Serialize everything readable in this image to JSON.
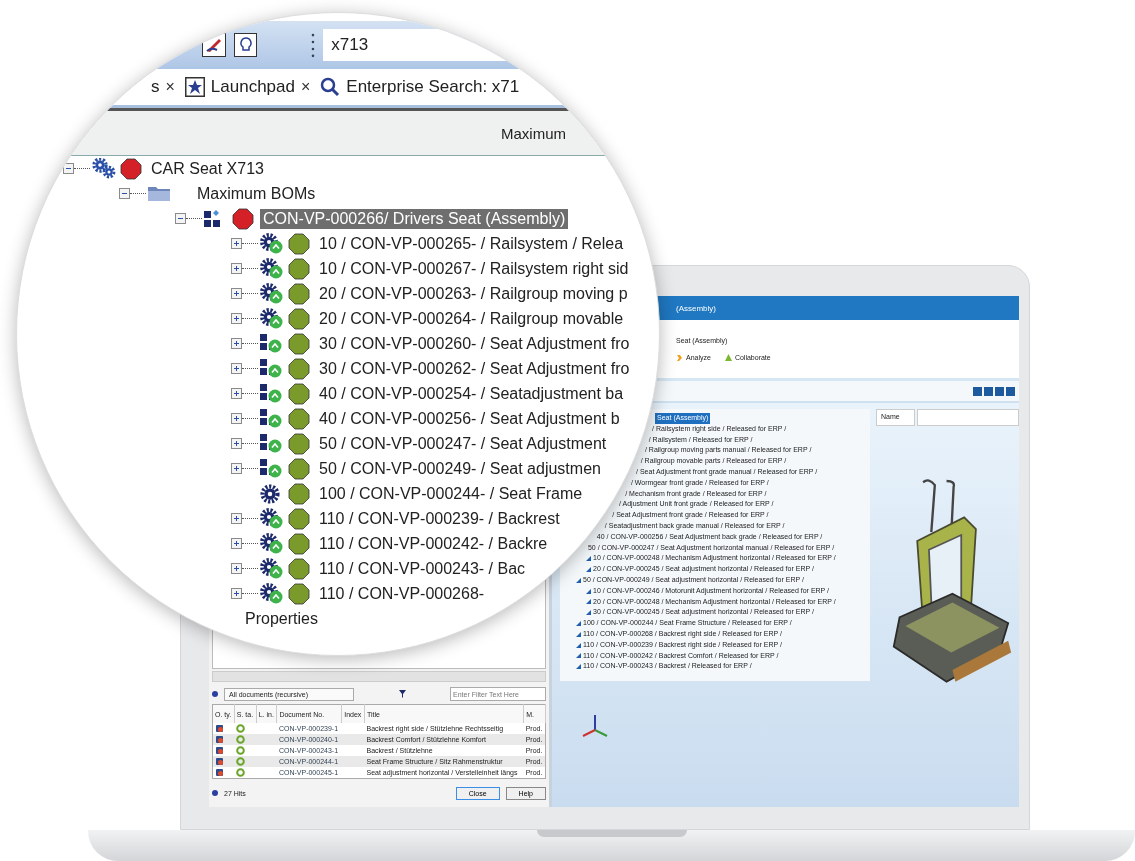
{
  "magnifier": {
    "toolbar": {
      "search": {
        "value": "x713"
      }
    },
    "tabs": [
      {
        "label": "s",
        "close": "×"
      },
      {
        "label": "Launchpad",
        "kind": "star",
        "close": "×"
      },
      {
        "label": "Enterprise Search: x71",
        "kind": "search"
      }
    ],
    "header": "Maximum",
    "tree": [
      {
        "label": "CAR Seat X713",
        "kind": "gears",
        "color": "#d42027",
        "expanded": true,
        "selected": false,
        "children": [
          {
            "label": "Maximum BOMs",
            "kind": "folder",
            "expanded": true,
            "selected": false,
            "children": [
              {
                "label": "CON-VP-000266/ Drivers Seat (Assembly)",
                "kind": "blocks",
                "color": "#d42027",
                "expanded": true,
                "selected": true,
                "children": [
                  {
                    "label": "10 / CON-VP-000265- / Railsystem / Relea",
                    "kind": "gear-badge",
                    "color": "#7a9a2c",
                    "expanded": false,
                    "selected": false
                  },
                  {
                    "label": "10 / CON-VP-000267- / Railsystem right sid",
                    "kind": "gear-badge",
                    "color": "#7a9a2c",
                    "expanded": false,
                    "selected": false
                  },
                  {
                    "label": "20 / CON-VP-000263- / Railgroup moving p",
                    "kind": "gear-badge",
                    "color": "#7a9a2c",
                    "expanded": false,
                    "selected": false
                  },
                  {
                    "label": "20 / CON-VP-000264- / Railgroup movable",
                    "kind": "gear-badge",
                    "color": "#7a9a2c",
                    "expanded": false,
                    "selected": false
                  },
                  {
                    "label": "30 / CON-VP-000260- / Seat Adjustment fro",
                    "kind": "blocks-badge",
                    "color": "#7a9a2c",
                    "expanded": false,
                    "selected": false
                  },
                  {
                    "label": "30 / CON-VP-000262- / Seat Adjustment fro",
                    "kind": "blocks-badge",
                    "color": "#7a9a2c",
                    "expanded": false,
                    "selected": false
                  },
                  {
                    "label": "40 / CON-VP-000254- / Seatadjustment ba",
                    "kind": "blocks-badge",
                    "color": "#7a9a2c",
                    "expanded": false,
                    "selected": false
                  },
                  {
                    "label": "40 / CON-VP-000256- / Seat Adjustment b",
                    "kind": "blocks-badge",
                    "color": "#7a9a2c",
                    "expanded": false,
                    "selected": false
                  },
                  {
                    "label": "50 / CON-VP-000247- / Seat Adjustment",
                    "kind": "blocks-badge",
                    "color": "#7a9a2c",
                    "expanded": false,
                    "selected": false
                  },
                  {
                    "label": "50 / CON-VP-000249- / Seat adjustmen",
                    "kind": "blocks-badge",
                    "color": "#7a9a2c",
                    "expanded": false,
                    "selected": false
                  },
                  {
                    "label": "100 / CON-VP-000244- / Seat Frame",
                    "kind": "gear",
                    "color": "#7a9a2c",
                    "selected": false
                  },
                  {
                    "label": "110 / CON-VP-000239- / Backrest",
                    "kind": "gear-badge",
                    "color": "#7a9a2c",
                    "expanded": false,
                    "selected": false
                  },
                  {
                    "label": "110 / CON-VP-000242- / Backre",
                    "kind": "gear-badge",
                    "color": "#7a9a2c",
                    "expanded": false,
                    "selected": false
                  },
                  {
                    "label": "110 / CON-VP-000243- / Bac",
                    "kind": "gear-badge",
                    "color": "#7a9a2c",
                    "expanded": false,
                    "selected": false
                  },
                  {
                    "label": "110 / CON-VP-000268-",
                    "kind": "gear-badge",
                    "color": "#7a9a2c",
                    "expanded": false,
                    "selected": false
                  }
                ]
              }
            ]
          }
        ]
      }
    ],
    "properties_label": "Properties"
  },
  "left_pane": {
    "filter": {
      "dropdown": "All documents (recursive)",
      "placeholder": "Enter Filter Text Here"
    },
    "table": {
      "columns": [
        "O. ty.",
        "S. ta.",
        "L. in.",
        "Document No.",
        "Index",
        "Title",
        "M."
      ],
      "rows": [
        {
          "document_no": "CON-VP-000239-1",
          "title": "Backrest right side / Stützlehne Rechtsseitig",
          "column_7": "Prod."
        },
        {
          "document_no": "CON-VP-000240-1",
          "title": "Backrest Comfort / Stützlehne Komfort",
          "column_7": "Prod."
        },
        {
          "document_no": "CON-VP-000243-1",
          "title": "Backrest / Stützlehne",
          "column_7": "Prod."
        },
        {
          "document_no": "CON-VP-000244-1",
          "title": "Seat Frame Structure / Sitz Rahmenstruktur",
          "column_7": "Prod."
        },
        {
          "document_no": "CON-VP-000245-1",
          "title": "Seat adjustment horizontal / Verstelleinheit längs",
          "column_7": "Prod."
        }
      ]
    },
    "status": "27 Hits",
    "buttons": [
      "Close",
      "Help"
    ]
  },
  "right_pane": {
    "title": "(Assembly)",
    "subtitle": "Seat (Assembly)",
    "actions": [
      {
        "label": "Analyze",
        "kind": "analyze"
      },
      {
        "label": "Collaborate",
        "kind": "collaborate"
      }
    ],
    "outline": [
      {
        "text": "Seat (Assembly)",
        "selected": true
      },
      {
        "text": "/ Railsystem right side / Released for ERP /",
        "selected": false
      },
      {
        "text": "/ Railsystem / Released for ERP /",
        "selected": false
      },
      {
        "text": "/ Railgroup moving parts manual / Released for ERP /",
        "selected": false
      },
      {
        "text": "/ Railgroup movable parts / Released for ERP /",
        "selected": false
      },
      {
        "text": "/ Seat Adjustment front grade manual / Released for ERP /",
        "selected": false
      },
      {
        "text": "/ Wormgear front grade / Released for ERP /",
        "selected": false
      },
      {
        "text": "/ Mechanism front grade / Released for ERP /",
        "selected": false
      },
      {
        "text": "/ Adjustment Unit front grade / Released for ERP /",
        "selected": false
      },
      {
        "text": "/ Seat Adjustment front grade / Released for ERP /",
        "selected": false
      },
      {
        "text": "/ Seatadjustment back grade manual / Released for ERP /",
        "selected": false
      },
      {
        "text": "40 / CON-VP-000256 / Seat Adjustment back grade / Released for ERP /",
        "selected": false
      },
      {
        "text": "50 / CON-VP-000247 / Seat Adjustment horizontal manual / Released for ERP /",
        "selected": false,
        "children": [
          {
            "text": "10 / CON-VP-000248 / Mechanism Adjustment horizontal / Released for ERP /",
            "selected": false
          },
          {
            "text": "20 / CON-VP-000245 / Seat adjustment horizontal / Released for ERP /",
            "selected": false
          }
        ]
      },
      {
        "text": "50 / CON-VP-000249 / Seat adjustment horizontal / Released for ERP /",
        "selected": false,
        "children": [
          {
            "text": "10 / CON-VP-000246 / Motorunit Adjustment horizontal / Released for ERP /",
            "selected": false
          },
          {
            "text": "20 / CON-VP-000248 / Mechanism Adjustment horizontal / Released for ERP /",
            "selected": false
          },
          {
            "text": "30 / CON-VP-000245 / Seat adjustment horizontal / Released for ERP /",
            "selected": false
          }
        ]
      },
      {
        "text": "100 / CON-VP-000244 / Seat Frame Structure / Released for ERP /",
        "selected": false
      },
      {
        "text": "110 / CON-VP-000268 / Backrest right side / Released for ERP /",
        "selected": false
      },
      {
        "text": "110 / CON-VP-000239 / Backrest right side / Released for ERP /",
        "selected": false
      },
      {
        "text": "110 / CON-VP-000242 / Backrest Comfort / Released for ERP /",
        "selected": false
      },
      {
        "text": "110 / CON-VP-000243 / Backrest / Released for ERP /",
        "selected": false
      }
    ],
    "viewer": {
      "dropdown": "Name"
    }
  }
}
